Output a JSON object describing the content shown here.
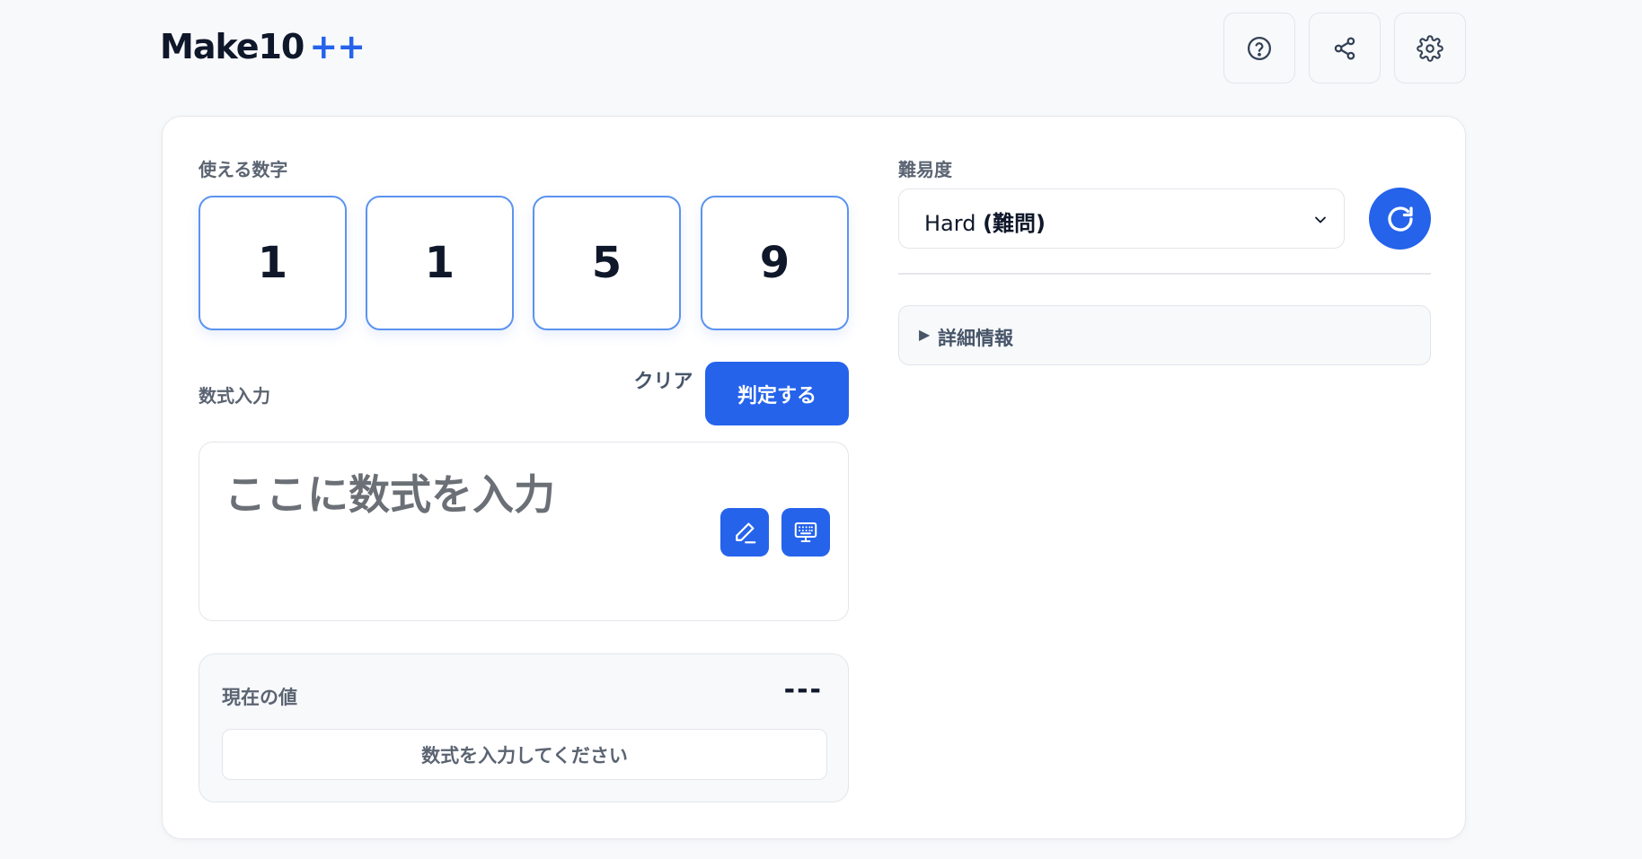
{
  "header": {
    "title": "Make10",
    "title_accent": "++",
    "buttons": [
      {
        "name": "help",
        "icon": "question-circle-icon"
      },
      {
        "name": "share",
        "icon": "share-icon"
      },
      {
        "name": "settings",
        "icon": "gear-icon"
      }
    ]
  },
  "numbers": {
    "label": "使える数字",
    "values": [
      "1",
      "1",
      "5",
      "9"
    ]
  },
  "expression": {
    "label": "数式入力",
    "clear_label": "クリア",
    "judge_label": "判定する",
    "placeholder": "ここに数式を入力",
    "tools": [
      {
        "name": "pen",
        "icon": "pen-icon"
      },
      {
        "name": "keyboard",
        "icon": "keyboard-icon"
      }
    ]
  },
  "current_value": {
    "label": "現在の値",
    "display": "---",
    "message": "数式を入力してください"
  },
  "difficulty": {
    "label": "難易度",
    "selected_en": "Hard",
    "selected_jp": "(難問)",
    "refresh_icon": "refresh-icon"
  },
  "details": {
    "arrow": "▶",
    "label": "詳細情報"
  },
  "colors": {
    "accent": "#2563eb",
    "number_border": "#5b93ef",
    "background": "#f8f9fb"
  }
}
